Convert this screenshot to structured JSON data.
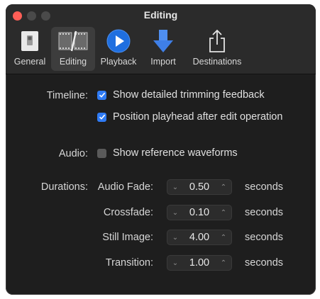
{
  "window": {
    "title": "Editing"
  },
  "toolbar": {
    "tabs": [
      {
        "label": "General",
        "icon": "general-switch-icon"
      },
      {
        "label": "Editing",
        "icon": "filmstrip-icon",
        "selected": true
      },
      {
        "label": "Playback",
        "icon": "play-circle-icon"
      },
      {
        "label": "Import",
        "icon": "down-arrow-icon"
      },
      {
        "label": "Destinations",
        "icon": "share-icon"
      }
    ]
  },
  "timeline": {
    "label": "Timeline:",
    "options": [
      {
        "label": "Show detailed trimming feedback",
        "checked": true
      },
      {
        "label": "Position playhead after edit operation",
        "checked": true
      }
    ]
  },
  "audio": {
    "label": "Audio:",
    "option": {
      "label": "Show reference waveforms",
      "checked": false
    }
  },
  "durations": {
    "label": "Durations:",
    "unit": "seconds",
    "items": [
      {
        "label": "Audio Fade:",
        "value": "0.50"
      },
      {
        "label": "Crossfade:",
        "value": "0.10"
      },
      {
        "label": "Still Image:",
        "value": "4.00"
      },
      {
        "label": "Transition:",
        "value": "1.00"
      }
    ]
  },
  "colors": {
    "accent": "#2f7bf5",
    "close": "#ff5f57",
    "background": "#1e1e1e"
  }
}
